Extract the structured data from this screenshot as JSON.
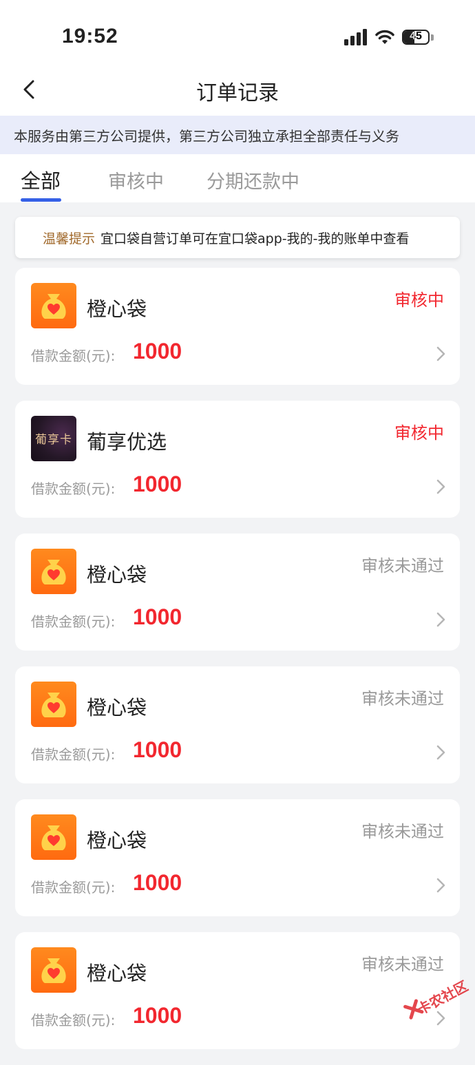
{
  "status_bar": {
    "time": "19:52",
    "battery": "45",
    "battery_level": 0.45
  },
  "nav": {
    "title": "订单记录"
  },
  "notice": {
    "text": "本服务由第三方公司提供，第三方公司独立承担全部责任与义务"
  },
  "tabs": [
    {
      "label": "全部",
      "active": true
    },
    {
      "label": "审核中",
      "active": false
    },
    {
      "label": "分期还款中",
      "active": false
    }
  ],
  "tip": {
    "label": "温馨提示",
    "text": "宜口袋自营订单可在宜口袋app-我的-我的账单中查看"
  },
  "colors": {
    "accent_blue": "#3560e6",
    "amount_red": "#f2272f",
    "status_gray": "#9a9a9a",
    "orange": "#ff7a14"
  },
  "orders": [
    {
      "name": "橙心袋",
      "status": "审核中",
      "status_type": "pending",
      "amount_label": "借款金额(元):",
      "amount": "1000",
      "logo": "orange-money-bag-icon"
    },
    {
      "name": "葡享优选",
      "status": "审核中",
      "status_type": "pending",
      "amount_label": "借款金额(元):",
      "amount": "1000",
      "logo": "putao-card-logo",
      "logo_text": "葡享卡"
    },
    {
      "name": "橙心袋",
      "status": "审核未通过",
      "status_type": "rejected",
      "amount_label": "借款金额(元):",
      "amount": "1000",
      "logo": "orange-money-bag-icon"
    },
    {
      "name": "橙心袋",
      "status": "审核未通过",
      "status_type": "rejected",
      "amount_label": "借款金额(元):",
      "amount": "1000",
      "logo": "orange-money-bag-icon"
    },
    {
      "name": "橙心袋",
      "status": "审核未通过",
      "status_type": "rejected",
      "amount_label": "借款金额(元):",
      "amount": "1000",
      "logo": "orange-money-bag-icon"
    },
    {
      "name": "橙心袋",
      "status": "审核未通过",
      "status_type": "rejected",
      "amount_label": "借款金额(元):",
      "amount": "1000",
      "logo": "orange-money-bag-icon"
    }
  ],
  "watermark": {
    "text": "卡农社区"
  }
}
